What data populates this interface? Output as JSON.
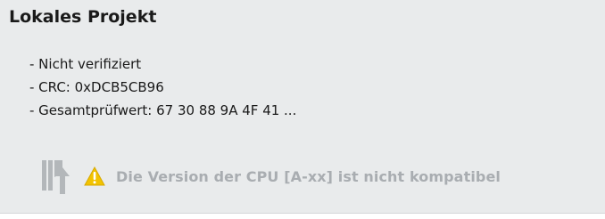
{
  "panel": {
    "title": "Lokales Projekt",
    "details": [
      "- Nicht verifiziert",
      "- CRC: 0xDCB5CB96",
      "- Gesamtprüfwert: 67 30 88 9A 4F 41 ..."
    ]
  },
  "status": {
    "download_icon": "download-to-device-icon",
    "warning_icon": "warning-triangle-icon",
    "message": "Die Version der CPU [A-xx] ist nicht kompatibel"
  },
  "colors": {
    "panel_background": "#e9ebec",
    "icon_gray": "#b3b7ba",
    "warning_yellow": "#f2c300",
    "disabled_text": "#a9adb1"
  }
}
